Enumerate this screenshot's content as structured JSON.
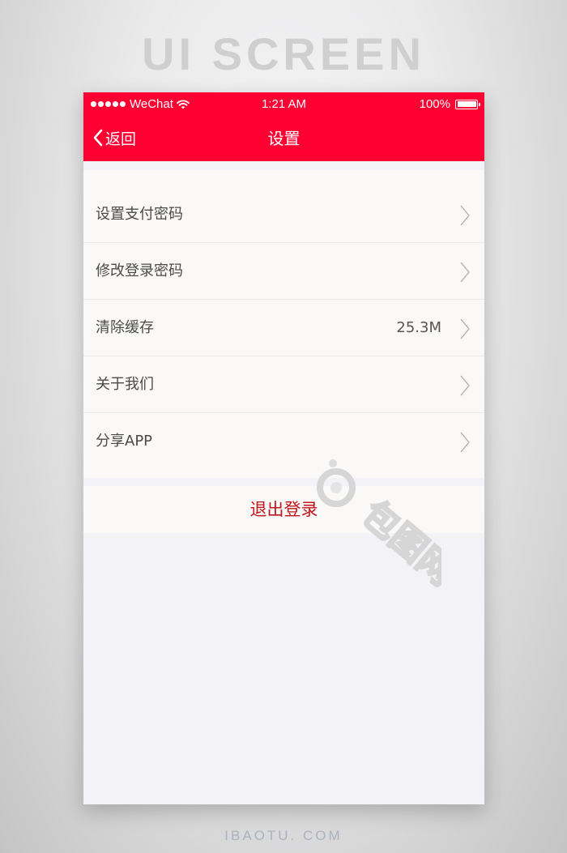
{
  "banner": {
    "title": "UI SCREEN"
  },
  "footer": {
    "brand": "IBAOTU. COM"
  },
  "status_bar": {
    "carrier": "WeChat",
    "time": "1:21 AM",
    "battery": "100%"
  },
  "nav": {
    "back_label": "返回",
    "title": "设置"
  },
  "menu": {
    "items": [
      {
        "label": "设置支付密码",
        "value": ""
      },
      {
        "label": "修改登录密码",
        "value": ""
      },
      {
        "label": "清除缓存",
        "value": "25.3M"
      },
      {
        "label": "关于我们",
        "value": ""
      },
      {
        "label": "分享APP",
        "value": ""
      }
    ]
  },
  "logout": {
    "label": "退出登录"
  },
  "colors": {
    "header_red": "#fe0032",
    "logout_text": "#c0151b",
    "page_bg": "#f2f2f7",
    "list_bg": "#faf9f7"
  },
  "watermark": {
    "text": "包图网"
  }
}
